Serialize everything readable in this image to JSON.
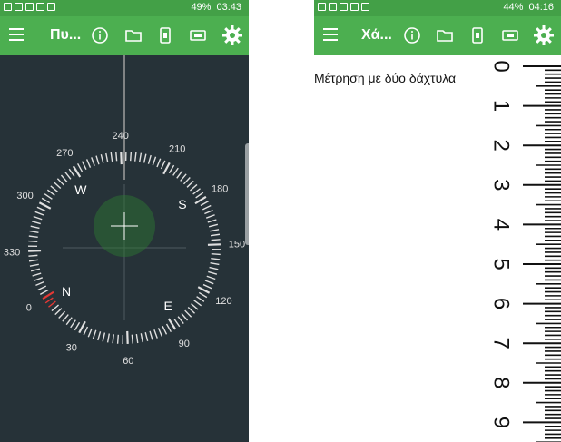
{
  "left_screen": {
    "status": {
      "battery": "49%",
      "time": "03:43"
    },
    "app_title": "Πυ...",
    "toolbar_icons": [
      "menu-icon",
      "info-icon",
      "folder-icon",
      "phone-icon",
      "battery-icon",
      "gear-icon"
    ],
    "compass": {
      "degree_labels": [
        "0",
        "30",
        "60",
        "90",
        "120",
        "150",
        "180",
        "210",
        "240",
        "270",
        "300",
        "330"
      ],
      "cardinals": {
        "north": "N",
        "east": "E",
        "south": "S",
        "west": "W"
      },
      "colors": {
        "background": "#263238",
        "ticks": "#e0e0e0",
        "north_marker": "#e53935",
        "level_bubble": "#2e7d32"
      }
    }
  },
  "right_screen": {
    "status": {
      "battery": "44%",
      "time": "04:16"
    },
    "app_title": "Χά...",
    "toolbar_icons": [
      "menu-icon",
      "info-icon",
      "folder-icon",
      "phone-icon",
      "battery-icon",
      "gear-icon"
    ],
    "caption": "Μέτρηση με δύο δάχτυλα",
    "ruler_numbers": [
      "0",
      "1",
      "2",
      "3",
      "4",
      "5",
      "6",
      "7",
      "8",
      "9"
    ]
  },
  "colors": {
    "status_bar": "#43a047",
    "app_bar": "#4caf50"
  }
}
